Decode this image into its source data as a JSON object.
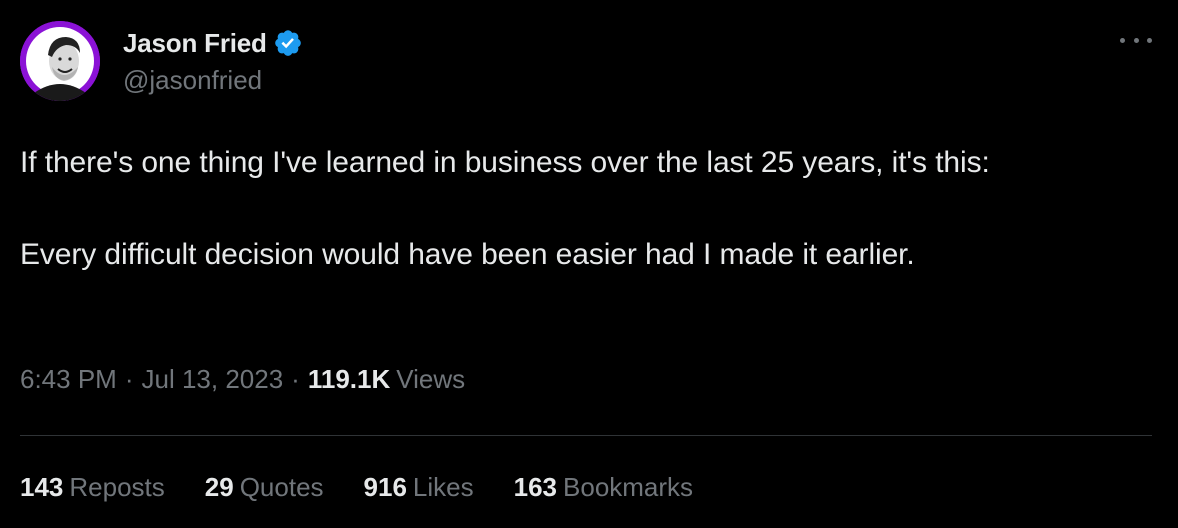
{
  "author": {
    "display_name": "Jason Fried",
    "handle": "@jasonfried",
    "verified_color": "#1d9bf0",
    "avatar_bg": "#8b12d6"
  },
  "tweet": {
    "line1": "If there's one thing I've learned in business over the last 25 years, it's this:",
    "line2": "Every difficult decision would have been easier had I made it earlier."
  },
  "meta": {
    "time": "6:43 PM",
    "separator": "·",
    "date": "Jul 13, 2023",
    "views_count": "119.1K",
    "views_label": "Views"
  },
  "stats": {
    "reposts_count": "143",
    "reposts_label": "Reposts",
    "quotes_count": "29",
    "quotes_label": "Quotes",
    "likes_count": "916",
    "likes_label": "Likes",
    "bookmarks_count": "163",
    "bookmarks_label": "Bookmarks"
  },
  "icons": {
    "more": "more-horizontal-icon",
    "verified": "verified-badge-icon"
  }
}
